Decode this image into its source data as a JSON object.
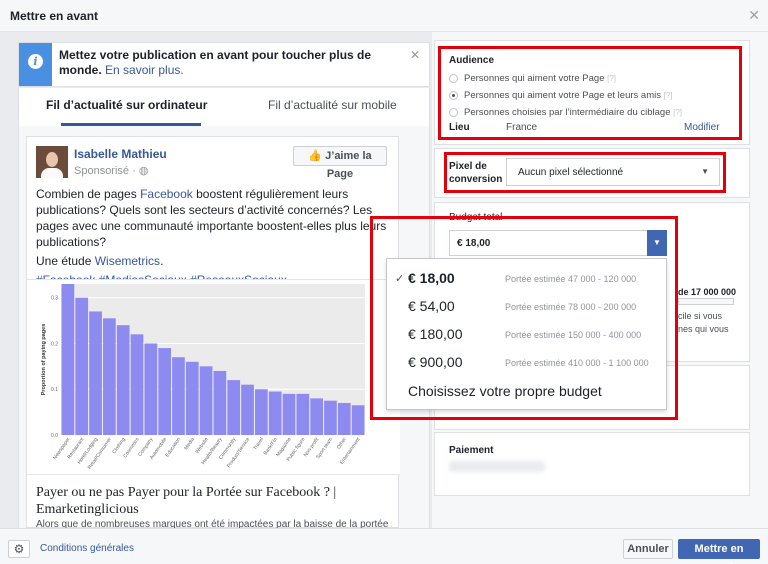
{
  "window": {
    "title": "Mettre en avant"
  },
  "notice": {
    "message": "Mettez votre publication en avant pour toucher plus de monde.",
    "link": "En savoir plus."
  },
  "tabs": [
    {
      "label": "Fil d’actualité sur ordinateur"
    },
    {
      "label": "Fil d’actualité sur mobile"
    }
  ],
  "post": {
    "author": "Isabelle Mathieu",
    "subtitle": "Sponsorisé · ",
    "like_button": "J’aime la Page",
    "text_before_link": "Combien de pages ",
    "text_link": "Facebook",
    "text_after_link": " boostent régulièrement leurs publications? Quels sont les secteurs d’activité concernés? Les pages avec une communauté importante boostent-elles plus leurs publications?",
    "study_prefix": "Une étude ",
    "study_link": "Wisemetrics",
    "study_suffix": ".",
    "hashtags": "#Facebook #MediasSociaux #ReseauxSociaux",
    "link_title": "Payer ou ne pas Payer pour la Portée sur Facebook ? | Emarketinglicious",
    "link_desc": "Alors que de nombreuses marques ont été impactées par la baisse de la portée sur"
  },
  "chart_data": {
    "type": "bar",
    "ylabel": "Proportion of paying pages",
    "yticks": [
      "0.3",
      "0.2",
      "0.1",
      "0.0"
    ],
    "categories": [
      "Newspaper",
      "Restaurant",
      "Hotel/Lodging",
      "Retail/Consumer",
      "Clothing",
      "Cosmetics",
      "Company",
      "Automobile",
      "Education",
      "Media",
      "Website",
      "Health/Beauty",
      "Community",
      "Product/Service",
      "Travel",
      "Bank/Fin",
      "Magazine",
      "Public figure",
      "Non-profit",
      "Sport team",
      "Other",
      "Entertainment"
    ],
    "values": [
      0.33,
      0.3,
      0.27,
      0.255,
      0.24,
      0.22,
      0.2,
      0.19,
      0.17,
      0.16,
      0.15,
      0.14,
      0.12,
      0.11,
      0.1,
      0.095,
      0.09,
      0.09,
      0.08,
      0.075,
      0.07,
      0.065
    ],
    "ylim": [
      0,
      0.33
    ],
    "color": "#8d8bf0"
  },
  "audience": {
    "title": "Audience",
    "options": [
      {
        "label": "Personnes qui aiment votre Page",
        "hint": "[?]",
        "selected": false
      },
      {
        "label": "Personnes qui aiment votre Page et leurs amis",
        "hint": "[?]",
        "selected": true
      },
      {
        "label": "Personnes choisies par l’intermédiaire du ciblage",
        "hint": "[?]",
        "selected": false
      }
    ],
    "location_label": "Lieu",
    "location_value": "France",
    "edit_link": "Modifier"
  },
  "pixel": {
    "label_line1": "Pixel de",
    "label_line2": "conversion",
    "value": "Aucun pixel sélectionné"
  },
  "budget": {
    "title": "Budget total",
    "selected": "€ 18,00",
    "reach_max": "de 17 000 000",
    "partial_text_1": "cile si vous",
    "partial_text_2": "nes qui vous",
    "options": [
      {
        "amount": "€ 18,00",
        "reach": "Portée estimée 47 000 - 120 000",
        "selected": true
      },
      {
        "amount": "€ 54,00",
        "reach": "Portée estimée 78 000 - 200 000",
        "selected": false
      },
      {
        "amount": "€ 180,00",
        "reach": "Portée estimée 150 000 - 400 000",
        "selected": false
      },
      {
        "amount": "€ 900,00",
        "reach": "Portée estimée 410 000 - 1 100 000",
        "selected": false
      }
    ],
    "custom": "Choisissez votre propre budget"
  },
  "payment": {
    "title": "Paiement"
  },
  "footer": {
    "conditions": "Conditions générales",
    "cancel": "Annuler",
    "boost": "Mettre en avant"
  }
}
